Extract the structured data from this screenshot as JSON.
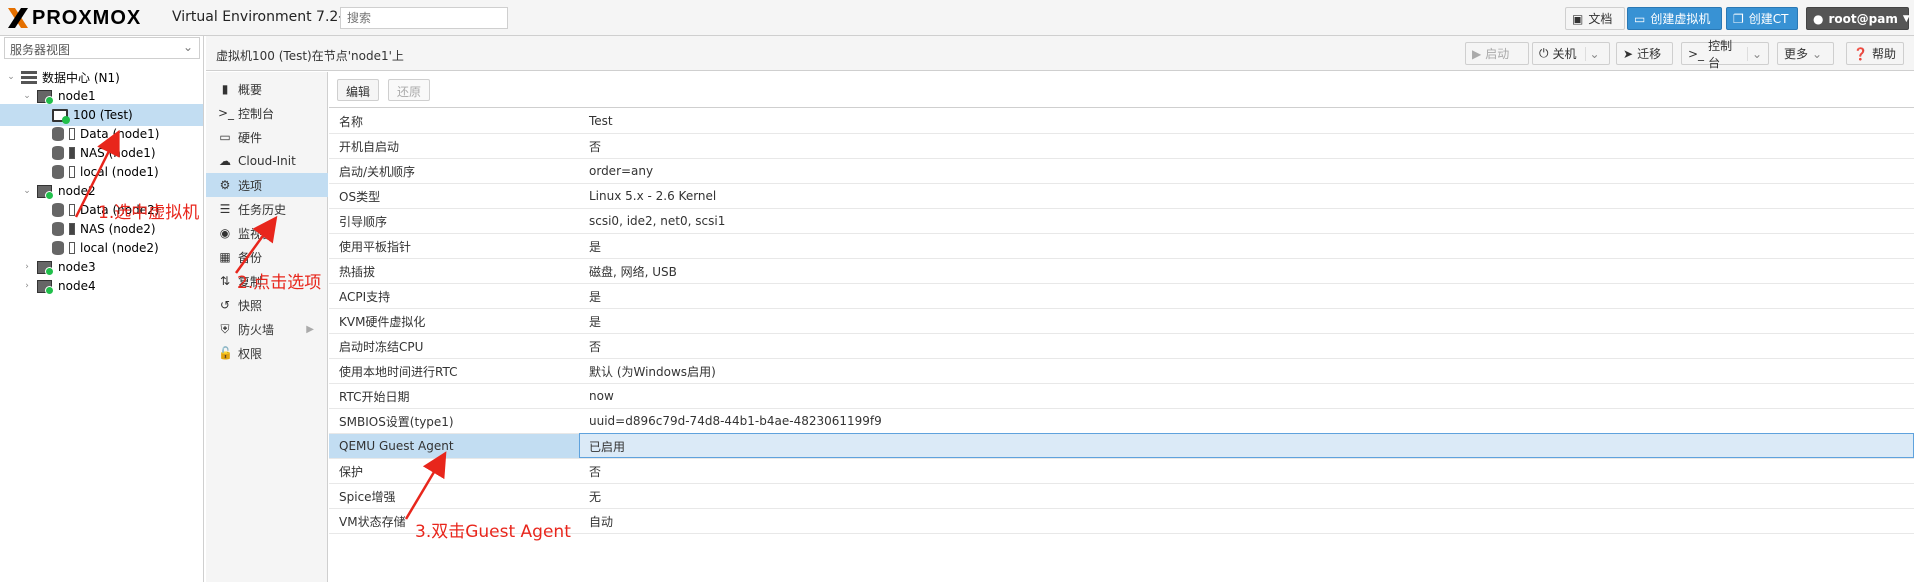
{
  "topbar": {
    "logo_text": "PROXMOX",
    "version": "Virtual Environment 7.2-3",
    "search_placeholder": "搜索",
    "docs_label": "文档",
    "create_vm_label": "创建虚拟机",
    "create_ct_label": "创建CT",
    "user_label": "root@pam"
  },
  "left": {
    "view_selector": "服务器视图",
    "tree": [
      {
        "label": "数据中心 (N1)"
      },
      {
        "label": "node1"
      },
      {
        "label": "100 (Test)"
      },
      {
        "label": "Data (node1)"
      },
      {
        "label": "NAS (node1)"
      },
      {
        "label": "local (node1)"
      },
      {
        "label": "node2"
      },
      {
        "label": "Data (node2)"
      },
      {
        "label": "NAS (node2)"
      },
      {
        "label": "local (node2)"
      },
      {
        "label": "node3"
      },
      {
        "label": "node4"
      }
    ]
  },
  "header": {
    "title": "虚拟机100 (Test)在节点'node1'上",
    "start_label": "启动",
    "shutdown_label": "关机",
    "migrate_label": "迁移",
    "console_label": "控制台",
    "more_label": "更多",
    "help_label": "帮助"
  },
  "subnav": {
    "items": [
      {
        "label": "概要",
        "icon": "book-icon"
      },
      {
        "label": "控制台",
        "icon": "terminal-icon"
      },
      {
        "label": "硬件",
        "icon": "monitor-icon"
      },
      {
        "label": "Cloud-Init",
        "icon": "cloud-icon"
      },
      {
        "label": "选项",
        "icon": "gear-icon"
      },
      {
        "label": "任务历史",
        "icon": "list-icon"
      },
      {
        "label": "监视器",
        "icon": "eye-icon"
      },
      {
        "label": "备份",
        "icon": "save-icon"
      },
      {
        "label": "复制",
        "icon": "retweet-icon"
      },
      {
        "label": "快照",
        "icon": "history-icon"
      },
      {
        "label": "防火墙",
        "icon": "shield-icon"
      },
      {
        "label": "权限",
        "icon": "unlock-icon"
      }
    ]
  },
  "content": {
    "edit_label": "编辑",
    "revert_label": "还原",
    "rows": [
      {
        "key": "名称",
        "value": "Test"
      },
      {
        "key": "开机自启动",
        "value": "否"
      },
      {
        "key": "启动/关机顺序",
        "value": "order=any"
      },
      {
        "key": "OS类型",
        "value": "Linux 5.x - 2.6 Kernel"
      },
      {
        "key": "引导顺序",
        "value": "scsi0, ide2, net0, scsi1"
      },
      {
        "key": "使用平板指针",
        "value": "是"
      },
      {
        "key": "热插拔",
        "value": "磁盘, 网络, USB"
      },
      {
        "key": "ACPI支持",
        "value": "是"
      },
      {
        "key": "KVM硬件虚拟化",
        "value": "是"
      },
      {
        "key": "启动时冻结CPU",
        "value": "否"
      },
      {
        "key": "使用本地时间进行RTC",
        "value": "默认 (为Windows启用)"
      },
      {
        "key": "RTC开始日期",
        "value": "now"
      },
      {
        "key": "SMBIOS设置(type1)",
        "value": "uuid=d896c79d-74d8-44b1-b4ae-4823061199f9"
      },
      {
        "key": "QEMU Guest Agent",
        "value": "已启用"
      },
      {
        "key": "保护",
        "value": "否"
      },
      {
        "key": "Spice增强",
        "value": "无"
      },
      {
        "key": "VM状态存储",
        "value": "自动"
      }
    ]
  },
  "annotations": {
    "step1": "1.选中虚拟机",
    "step2": "2.点击选项",
    "step3": "3.双击Guest Agent"
  }
}
